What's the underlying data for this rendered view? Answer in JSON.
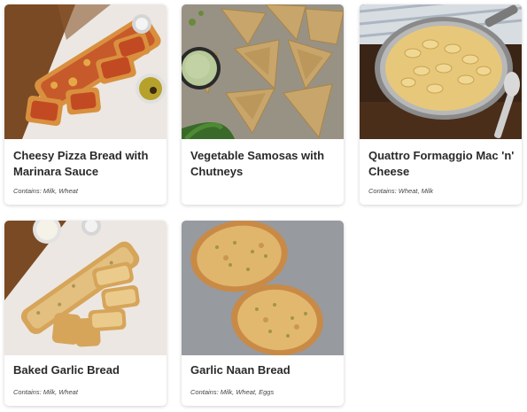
{
  "menu_items": [
    {
      "title": "Cheesy Pizza Bread with Marinara Sauce",
      "contains": "Contains: Milk, Wheat",
      "image_icon": "pizza-bread-image"
    },
    {
      "title": "Vegetable Samosas with Chutneys",
      "contains": "",
      "image_icon": "samosas-image"
    },
    {
      "title": "Quattro Formaggio Mac 'n' Cheese",
      "contains": "Contains: Wheat, Milk",
      "image_icon": "mac-and-cheese-image"
    },
    {
      "title": "Baked Garlic Bread",
      "contains": "Contains: Milk, Wheat",
      "image_icon": "garlic-bread-image"
    },
    {
      "title": "Garlic Naan Bread",
      "contains": "Contains: Milk, Wheat, Eggs",
      "image_icon": "naan-bread-image"
    }
  ]
}
